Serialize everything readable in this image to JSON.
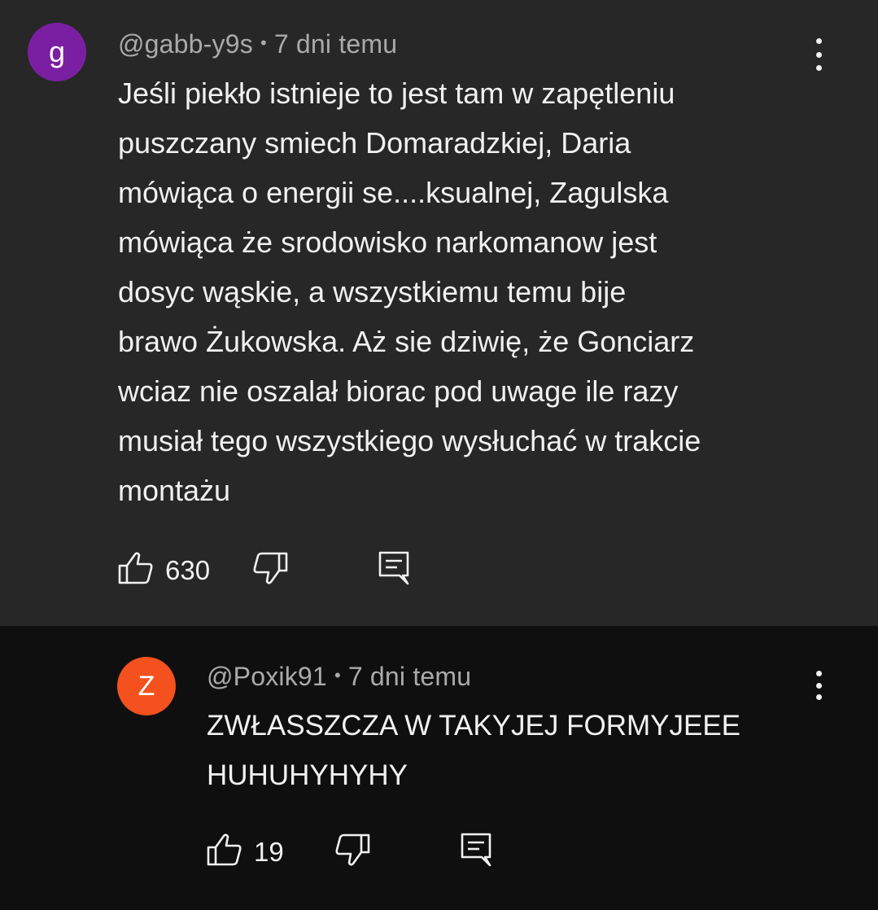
{
  "comments": [
    {
      "avatar_letter": "g",
      "avatar_color": "#7b1fa2",
      "author": "@gabb-y9s",
      "separator": "•",
      "time": "7 dni temu",
      "text": "Jeśli piekło istnieje to jest tam w zapętleniu\npuszczany smiech Domaradzkiej, Daria\nmówiąca o energii se....ksualnej, Zagulska\nmówiąca że srodowisko narkomanow jest\ndosyc wąskie, a wszystkiemu temu bije\nbrawo Żukowska. Aż sie dziwię, że Gonciarz\nwciaz nie oszalał biorac pod uwage ile razy\nmusiał tego wszystkiego wysłuchać w trakcie\nmontażu",
      "likes": "630",
      "icons": [
        "like-icon",
        "dislike-icon",
        "reply-icon",
        "more-options-icon"
      ]
    },
    {
      "avatar_letter": "Z",
      "avatar_color": "#f4511e",
      "author": "@Poxik91",
      "separator": "•",
      "time": "7 dni temu",
      "text": "ZWŁASSZCZA W TAKYJEJ FORMYJEEE\nHUHUHYHYHY",
      "likes": "19",
      "icons": [
        "like-icon",
        "dislike-icon",
        "reply-icon",
        "more-options-icon"
      ]
    }
  ],
  "colors": {
    "main_background": "#272727",
    "reply_background": "#0f0f0f",
    "meta_text": "#aaaaaa",
    "body_text": "#f1f1f1"
  }
}
